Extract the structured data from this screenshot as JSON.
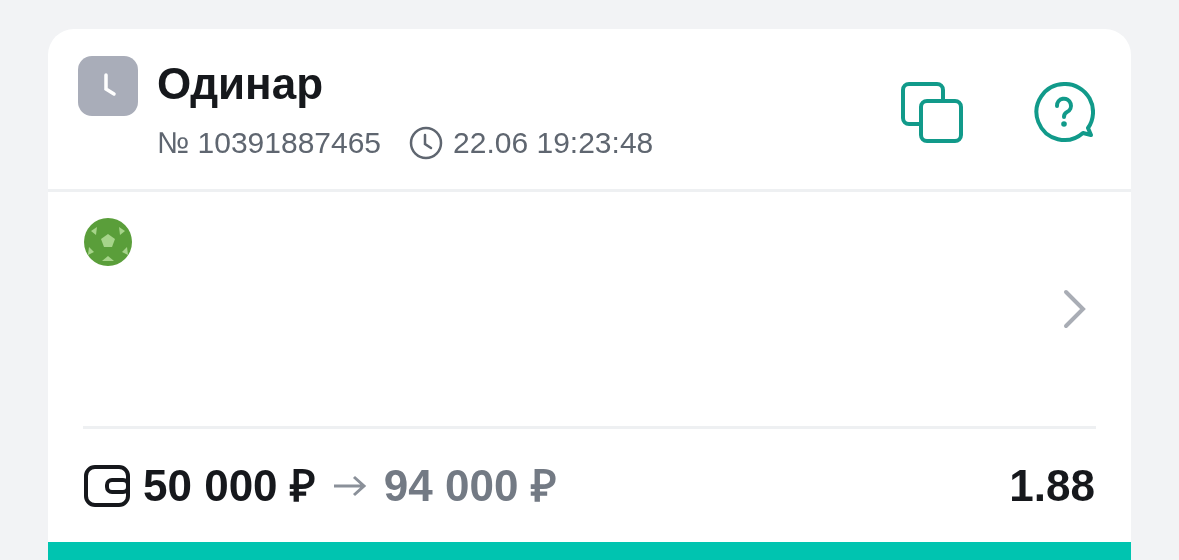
{
  "bet": {
    "type": "Одинар",
    "number": "№ 10391887465",
    "datetime": "22.06 19:23:48",
    "stake": "50 000 ₽",
    "payout": "94 000 ₽",
    "odds": "1.88"
  }
}
